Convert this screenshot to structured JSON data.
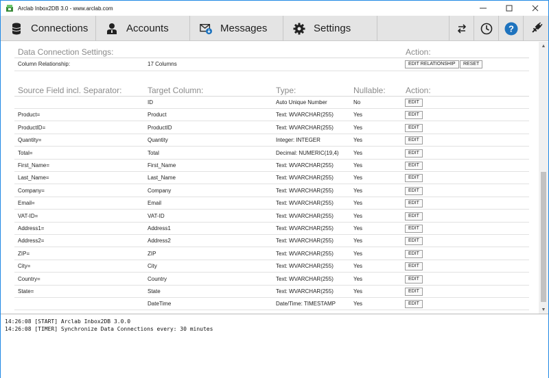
{
  "window": {
    "title": "Arclab Inbox2DB 3.0 - www.arclab.com",
    "controls": [
      "minimize",
      "maximize",
      "close"
    ]
  },
  "toolbar": {
    "tabs": [
      {
        "label": "Connections",
        "icon": "database-icon"
      },
      {
        "label": "Accounts",
        "icon": "user-icon"
      },
      {
        "label": "Messages",
        "icon": "mail-download-icon"
      },
      {
        "label": "Settings",
        "icon": "gear-icon"
      }
    ],
    "icon_buttons": [
      "sync-arrows-icon",
      "clock-icon",
      "help-icon",
      "plugin-icon"
    ],
    "accent": "#1e73be"
  },
  "settings": {
    "header": "Data Connection Settings:",
    "action_header": "Action:",
    "column_relationship_label": "Column Relationship:",
    "column_relationship_value": "17 Columns",
    "edit_relationship_label": "EDIT RELATIONSHIP",
    "reset_label": "RESET"
  },
  "columns_table": {
    "headers": {
      "source": "Source Field incl. Separator:",
      "target": "Target Column:",
      "type": "Type:",
      "nullable": "Nullable:",
      "action": "Action:"
    },
    "edit_label": "EDIT",
    "rows": [
      {
        "source": "",
        "target": "ID",
        "type": "Auto Unique Number",
        "nullable": "No"
      },
      {
        "source": "Product=",
        "target": "Product",
        "type": "Text: WVARCHAR(255)",
        "nullable": "Yes"
      },
      {
        "source": "ProductID=",
        "target": "ProductID",
        "type": "Text: WVARCHAR(255)",
        "nullable": "Yes"
      },
      {
        "source": "Quantity=",
        "target": "Quantity",
        "type": "Integer: INTEGER",
        "nullable": "Yes"
      },
      {
        "source": "Total=",
        "target": "Total",
        "type": "Decimal: NUMERIC(19,4)",
        "nullable": "Yes"
      },
      {
        "source": "First_Name=",
        "target": "First_Name",
        "type": "Text: WVARCHAR(255)",
        "nullable": "Yes"
      },
      {
        "source": "Last_Name=",
        "target": "Last_Name",
        "type": "Text: WVARCHAR(255)",
        "nullable": "Yes"
      },
      {
        "source": "Company=",
        "target": "Company",
        "type": "Text: WVARCHAR(255)",
        "nullable": "Yes"
      },
      {
        "source": "Email=",
        "target": "Email",
        "type": "Text: WVARCHAR(255)",
        "nullable": "Yes"
      },
      {
        "source": "VAT-ID=",
        "target": "VAT-ID",
        "type": "Text: WVARCHAR(255)",
        "nullable": "Yes"
      },
      {
        "source": "Address1=",
        "target": "Address1",
        "type": "Text: WVARCHAR(255)",
        "nullable": "Yes"
      },
      {
        "source": "Address2=",
        "target": "Address2",
        "type": "Text: WVARCHAR(255)",
        "nullable": "Yes"
      },
      {
        "source": "ZIP=",
        "target": "ZIP",
        "type": "Text: WVARCHAR(255)",
        "nullable": "Yes"
      },
      {
        "source": "City=",
        "target": "City",
        "type": "Text: WVARCHAR(255)",
        "nullable": "Yes"
      },
      {
        "source": "Country=",
        "target": "Country",
        "type": "Text: WVARCHAR(255)",
        "nullable": "Yes"
      },
      {
        "source": "State=",
        "target": "State",
        "type": "Text: WVARCHAR(255)",
        "nullable": "Yes"
      },
      {
        "source": "",
        "target": "DateTime",
        "type": "Date/Time: TIMESTAMP",
        "nullable": "Yes"
      }
    ]
  },
  "log": {
    "lines": [
      "14:26:08 [START] Arclab Inbox2DB 3.0.0",
      "14:26:08 [TIMER] Synchronize Data Connections every: 30 minutes"
    ]
  }
}
